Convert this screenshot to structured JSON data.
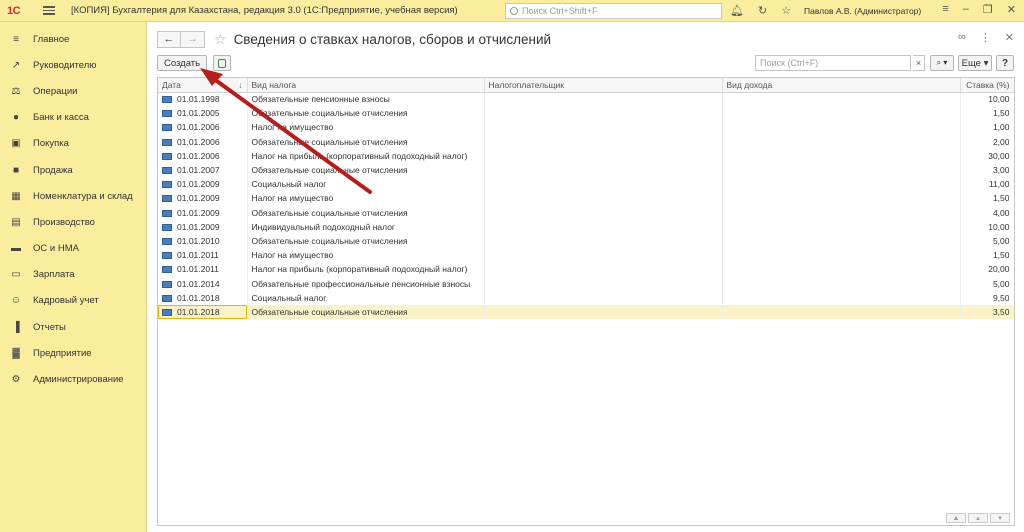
{
  "app": {
    "logo": "1С",
    "title": "[КОПИЯ] Бухгалтерия для Казахстана, редакция 3.0  (1С:Предприятие, учебная версия)",
    "search_placeholder": "Поиск Ctrl+Shift+F",
    "user": "Павлов А.В. (Администратор)"
  },
  "sidebar": {
    "items": [
      {
        "label": "Главное",
        "icon": "menu-icon"
      },
      {
        "label": "Руководителю",
        "icon": "trend-icon"
      },
      {
        "label": "Операции",
        "icon": "operations-icon"
      },
      {
        "label": "Банк и касса",
        "icon": "coin-icon"
      },
      {
        "label": "Покупка",
        "icon": "cart-icon"
      },
      {
        "label": "Продажа",
        "icon": "bag-icon"
      },
      {
        "label": "Номенклатура и склад",
        "icon": "grid-icon"
      },
      {
        "label": "Производство",
        "icon": "factory-icon"
      },
      {
        "label": "ОС и НМА",
        "icon": "truck-icon"
      },
      {
        "label": "Зарплата",
        "icon": "wallet-icon"
      },
      {
        "label": "Кадровый учет",
        "icon": "people-icon"
      },
      {
        "label": "Отчеты",
        "icon": "chart-icon"
      },
      {
        "label": "Предприятие",
        "icon": "building-icon"
      },
      {
        "label": "Администрирование",
        "icon": "gear-icon"
      }
    ]
  },
  "page": {
    "title": "Сведения о ставках налогов, сборов и отчислений",
    "create_label": "Создать",
    "search_placeholder": "Поиск (Ctrl+F)",
    "more_label": "Еще",
    "help_label": "?"
  },
  "table": {
    "columns": [
      "Дата",
      "Вид налога",
      "Налогоплательщик",
      "Вид дохода",
      "Ставка (%)"
    ],
    "rows": [
      {
        "date": "01.01.1998",
        "tax": "Обязательные пенсионные взносы",
        "payer": "",
        "income": "",
        "rate": "10,00"
      },
      {
        "date": "01.01.2005",
        "tax": "Обязательные социальные отчисления",
        "payer": "",
        "income": "",
        "rate": "1,50"
      },
      {
        "date": "01.01.2006",
        "tax": "Налог на имущество",
        "payer": "",
        "income": "",
        "rate": "1,00"
      },
      {
        "date": "01.01.2006",
        "tax": "Обязательные социальные отчисления",
        "payer": "",
        "income": "",
        "rate": "2,00"
      },
      {
        "date": "01.01.2006",
        "tax": "Налог на прибыль (корпоративный подоходный налог)",
        "payer": "",
        "income": "",
        "rate": "30,00"
      },
      {
        "date": "01.01.2007",
        "tax": "Обязательные социальные отчисления",
        "payer": "",
        "income": "",
        "rate": "3,00"
      },
      {
        "date": "01.01.2009",
        "tax": "Социальный налог",
        "payer": "",
        "income": "",
        "rate": "11,00"
      },
      {
        "date": "01.01.2009",
        "tax": "Налог на имущество",
        "payer": "",
        "income": "",
        "rate": "1,50"
      },
      {
        "date": "01.01.2009",
        "tax": "Обязательные социальные отчисления",
        "payer": "",
        "income": "",
        "rate": "4,00"
      },
      {
        "date": "01.01.2009",
        "tax": "Индивидуальный подоходный налог",
        "payer": "",
        "income": "",
        "rate": "10,00"
      },
      {
        "date": "01.01.2010",
        "tax": "Обязательные социальные отчисления",
        "payer": "",
        "income": "",
        "rate": "5,00"
      },
      {
        "date": "01.01.2011",
        "tax": "Налог на имущество",
        "payer": "",
        "income": "",
        "rate": "1,50"
      },
      {
        "date": "01.01.2011",
        "tax": "Налог на прибыль (корпоративный подоходный налог)",
        "payer": "",
        "income": "",
        "rate": "20,00"
      },
      {
        "date": "01.01.2014",
        "tax": "Обязательные профессиональные пенсионные взносы",
        "payer": "",
        "income": "",
        "rate": "5,00"
      },
      {
        "date": "01.01.2018",
        "tax": "Социальный налог",
        "payer": "",
        "income": "",
        "rate": "9,50"
      },
      {
        "date": "01.01.2018",
        "tax": "Обязательные социальные отчисления",
        "payer": "",
        "income": "",
        "rate": "3,50"
      }
    ],
    "selected_index": 15
  },
  "colors": {
    "sidebar_bg": "#fbed9e",
    "selected_row": "#fbf3c8",
    "annotation_arrow": "#b81c1c"
  }
}
